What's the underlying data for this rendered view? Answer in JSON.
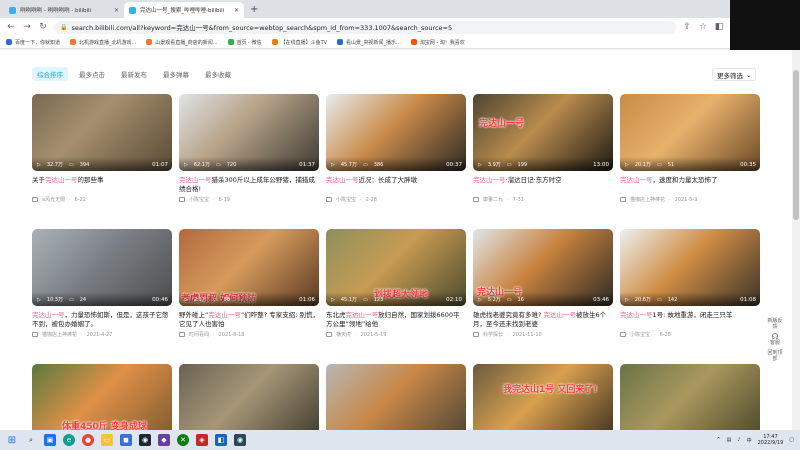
{
  "browser": {
    "tabs": [
      {
        "label": "咧咧咧咧 - 咧咧咧咧 - bilibili",
        "active": false
      },
      {
        "label": "完达山一号_搜索_哔哩哔哩-bilibili",
        "active": true
      }
    ],
    "new_tab": "+",
    "url": "search.bilibili.com/all?keyword=完达山一号&from_source=webtop_search&spm_id_from=333.1007&search_source=5",
    "bookmarks": [
      "百度一下，你就知道",
      "北机游戏直播_北机游戏...",
      "山景观看直播_商店的新闻...",
      "首页 - 微信",
      "【在线直播】斗鱼TV",
      "看山景_央视新闻_播乐...",
      "淘宝网 - 淘！我喜欢"
    ]
  },
  "sort_tabs": [
    "综合排序",
    "最多点击",
    "最新发布",
    "最多弹幕",
    "最多收藏"
  ],
  "more_filter": "更多筛选",
  "videos": [
    {
      "views": "32.7万",
      "danmaku": "394",
      "duration": "01:07",
      "title_pre": "关于",
      "hl": "完达山一号",
      "title_post": "的那些事",
      "author": "a风光无限",
      "date": "8-22"
    },
    {
      "views": "62.1万",
      "danmaku": "720",
      "duration": "01:37",
      "title_pre": "",
      "hl": "完达山一号",
      "title_post": "猎杀300斤以上成年公野猪，捕猎成绩合格!",
      "author": "小陈宝宝",
      "date": "8-19"
    },
    {
      "views": "45.7万",
      "danmaku": "386",
      "duration": "00:37",
      "title_pre": "",
      "hl": "完达山一号",
      "title_post": "近况：长成了大胖墩",
      "author": "小陈宝宝",
      "date": "2-28"
    },
    {
      "views": "3.9万",
      "danmaku": "199",
      "duration": "13:00",
      "title_pre": "",
      "hl": "完达山一号",
      "title_post": "·溜达日记·东方时空",
      "author": "康董二九",
      "date": "7-31",
      "overlay": "完达山一号"
    },
    {
      "views": "20.1万",
      "danmaku": "51",
      "duration": "00:35",
      "title_pre": "",
      "hl": "完达山一号",
      "title_post": "，速度和力量太恐怖了",
      "author": "猫咖店上神棒花",
      "date": "2021-5-3"
    },
    {
      "views": "10.3万",
      "danmaku": "24",
      "duration": "00:46",
      "title_pre": "",
      "hl": "完达山一号",
      "title_post": "，力量恐怖如斯，但是，这孩子它憋不到，被包办婚姻了。",
      "author": "猫咖店上神棒花",
      "date": "2021-4-27"
    },
    {
      "views": "2.1万",
      "danmaku": "38",
      "duration": "01:06",
      "title_pre": "野外碰上“",
      "hl": "完达山一号",
      "title_post": "”们咋整? 专家支招: 别慌，它见了人也害怕",
      "author": "时间看闻",
      "date": "2021-8-18",
      "overlay": "老虎周叔 如何预防"
    },
    {
      "views": "45.1万",
      "danmaku": "123",
      "duration": "02:10",
      "title_pre": "东北虎",
      "hl": "完达山一号",
      "title_post": "放归自然，国家划拨6600平方公里“领地”给他",
      "author": "横天虎",
      "date": "2021-5-19",
      "overlay": "划拨超大领地"
    },
    {
      "views": "5.2万",
      "danmaku": "16",
      "duration": "03:46",
      "title_pre": "雄虎找老婆究竟有多难? ",
      "hl": "完达山一号",
      "title_post": "被放生6个月，至今还未找到老婆",
      "author": "科学探长",
      "date": "2021-11-10",
      "overlay": "完达山一号"
    },
    {
      "views": "20.6万",
      "danmaku": "142",
      "duration": "01:08",
      "title_pre": "",
      "hl": "完达山一号",
      "title_post": "1号: 故地重游，闭走三只羊",
      "author": "小陈宝宝",
      "date": "6-28"
    },
    {
      "views": "",
      "danmaku": "",
      "duration": "",
      "title_pre": "",
      "hl": "",
      "title_post": "",
      "author": "",
      "date": "",
      "overlay": "体重450斤 变身成球"
    },
    {
      "views": "",
      "danmaku": "",
      "duration": "",
      "title_pre": "",
      "hl": "",
      "title_post": "",
      "author": "",
      "date": ""
    },
    {
      "views": "",
      "danmaku": "",
      "duration": "",
      "title_pre": "",
      "hl": "",
      "title_post": "",
      "author": "",
      "date": ""
    },
    {
      "views": "",
      "danmaku": "",
      "duration": "",
      "title_pre": "",
      "hl": "",
      "title_post": "",
      "author": "",
      "date": "",
      "overlay": "我完达山1号 又回来了!"
    },
    {
      "views": "",
      "danmaku": "",
      "duration": "",
      "title_pre": "",
      "hl": "",
      "title_post": "",
      "author": "",
      "date": ""
    }
  ],
  "side_tools": [
    "新版反馈",
    "客服",
    "回到顶部"
  ],
  "taskbar": {
    "time": "17:47",
    "date": "2022/9/19",
    "lang": "中"
  }
}
